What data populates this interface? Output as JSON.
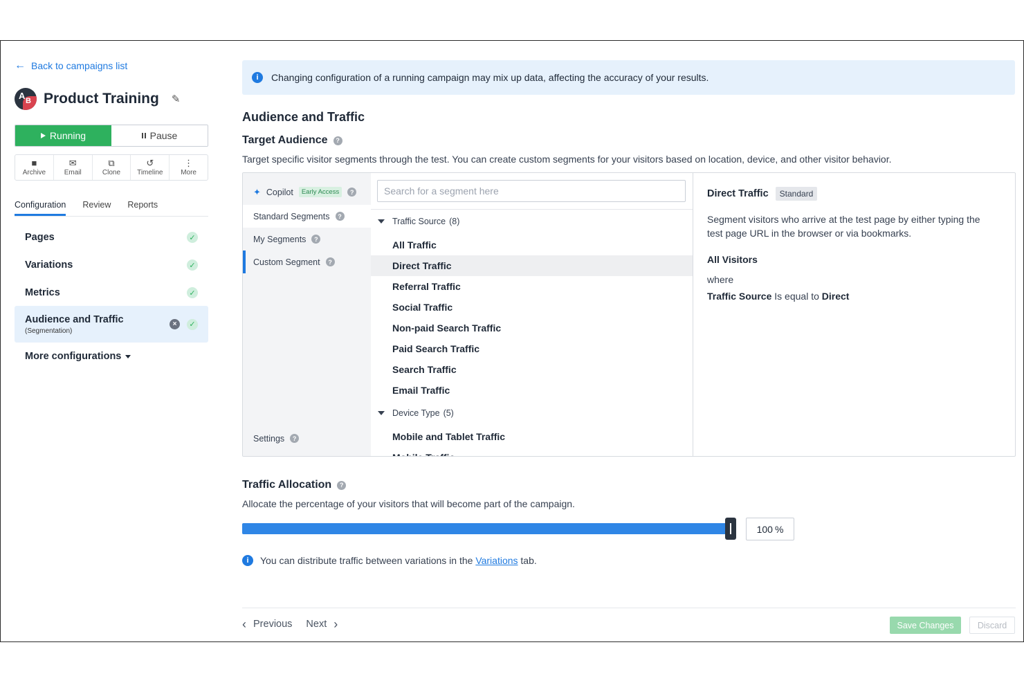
{
  "sidebar": {
    "back_link": "Back to campaigns list",
    "campaign_title": "Product Training",
    "logo_letters": {
      "a": "A",
      "b": "B"
    },
    "status": {
      "running": "Running",
      "pause": "Pause"
    },
    "actions": [
      "Archive",
      "Email",
      "Clone",
      "Timeline",
      "More"
    ],
    "tabs": [
      "Configuration",
      "Review",
      "Reports"
    ],
    "active_tab": "Configuration",
    "nav": [
      {
        "label": "Pages",
        "sub": ""
      },
      {
        "label": "Variations",
        "sub": ""
      },
      {
        "label": "Metrics",
        "sub": ""
      },
      {
        "label": "Audience and Traffic",
        "sub": "(Segmentation)"
      }
    ],
    "more_configurations": "More configurations"
  },
  "main": {
    "banner": "Changing configuration of a running campaign may mix up data, affecting the accuracy of your results.",
    "section_title": "Audience and Traffic",
    "target_audience": {
      "title": "Target Audience",
      "description": "Target specific visitor segments through the test. You can create custom segments for your visitors based on location, device, and other visitor behavior."
    },
    "segments": {
      "left": {
        "copilot": "Copilot",
        "early_access": "Early Access",
        "standard": "Standard Segments",
        "my": "My Segments",
        "custom": "Custom Segment",
        "settings": "Settings"
      },
      "search_placeholder": "Search for a segment here",
      "groups": [
        {
          "name": "Traffic Source",
          "count": "(8)",
          "items": [
            "All Traffic",
            "Direct Traffic",
            "Referral Traffic",
            "Social Traffic",
            "Non-paid Search Traffic",
            "Paid Search Traffic",
            "Search Traffic",
            "Email Traffic"
          ]
        },
        {
          "name": "Device Type",
          "count": "(5)",
          "items": [
            "Mobile and Tablet Traffic",
            "Mobile Traffic"
          ]
        }
      ],
      "selected": "Direct Traffic",
      "detail": {
        "title": "Direct Traffic",
        "badge": "Standard",
        "description": "Segment visitors who arrive at the test page by either typing the test page URL in the browser or via bookmarks.",
        "heading": "All Visitors",
        "where": "where",
        "condition": {
          "field": "Traffic Source",
          "operator": "Is equal to",
          "value": "Direct"
        }
      }
    },
    "traffic_allocation": {
      "title": "Traffic Allocation",
      "description": "Allocate the percentage of your visitors that will become part of the campaign.",
      "value": 100,
      "display": "100",
      "unit": "%",
      "note_before": "You can distribute traffic between variations in the",
      "note_link": "Variations",
      "note_after": "tab."
    },
    "footer": {
      "previous": "Previous",
      "next": "Next",
      "save": "Save Changes",
      "discard": "Discard"
    }
  },
  "colors": {
    "accent": "#1f7ae0",
    "running": "#2eb15e",
    "slider": "#2f86e6",
    "banner_bg": "#e6f1fc"
  }
}
